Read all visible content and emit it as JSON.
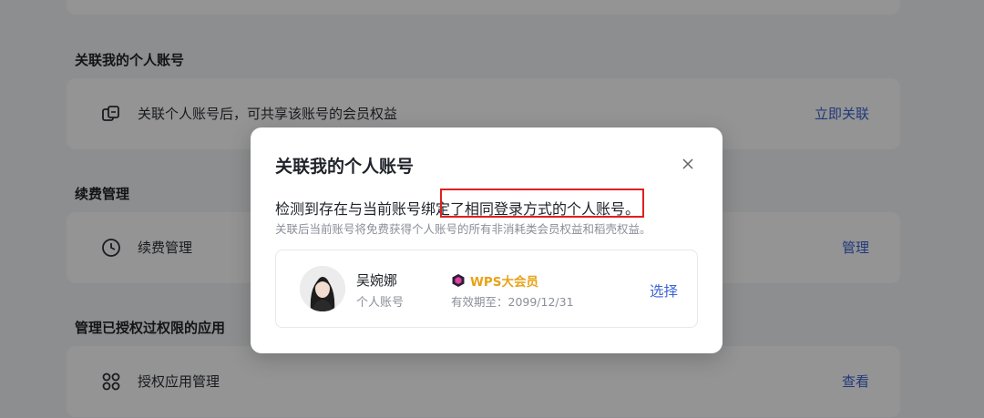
{
  "sections": {
    "link_account": {
      "title": "关联我的个人账号",
      "row_text": "关联个人账号后，可共享该账号的会员权益",
      "action_label": "立即关联",
      "icon": "link-account-icon"
    },
    "renewal": {
      "title": "续费管理",
      "row_text": "续费管理",
      "action_label": "管理",
      "icon": "clock-icon"
    },
    "apps": {
      "title": "管理已授权过权限的应用",
      "row_text": "授权应用管理",
      "action_label": "查看",
      "icon": "apps-grid-icon"
    }
  },
  "modal": {
    "title": "关联我的个人账号",
    "main_text": "检测到存在与当前账号绑定了相同登录方式的个人账号。",
    "sub_text": "关联后当前账号将免费获得个人账号的所有非消耗类会员权益和稻壳权益。",
    "account": {
      "name": "吴婉娜",
      "type": "个人账号",
      "vip_label": "WPS大会员",
      "expire": "有效期至：2099/12/31",
      "select_label": "选择"
    }
  },
  "colors": {
    "accent": "#3a63d6",
    "vip": "#e8a218",
    "highlight": "#e02020"
  }
}
